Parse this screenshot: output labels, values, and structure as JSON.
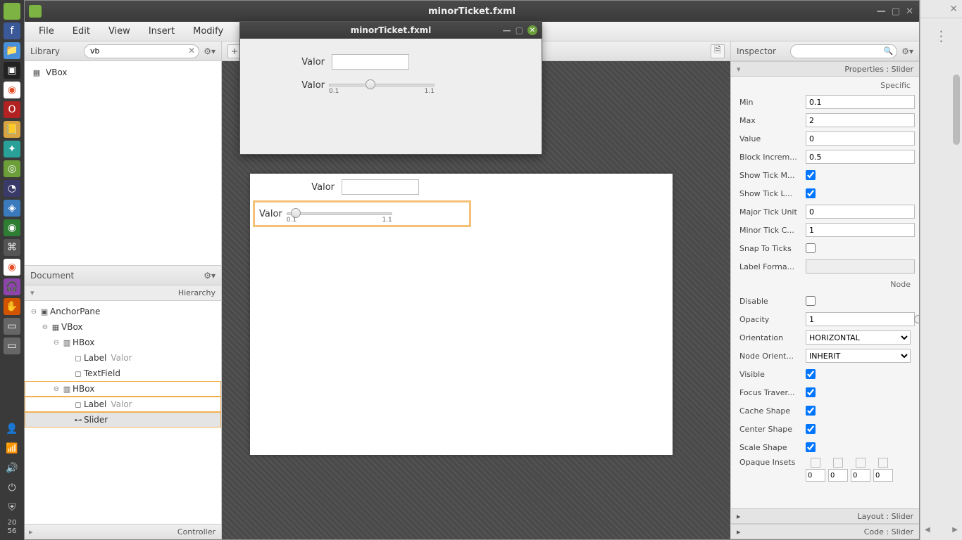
{
  "os": {
    "clock_h": "20",
    "clock_m": "56"
  },
  "window": {
    "title": "minorTicket.fxml"
  },
  "menu": {
    "file": "File",
    "edit": "Edit",
    "view": "View",
    "insert": "Insert",
    "modify": "Modify"
  },
  "library": {
    "title": "Library",
    "search": "vb",
    "item1": "VBox"
  },
  "document": {
    "title": "Document",
    "hierarchy": "Hierarchy",
    "controller": "Controller",
    "tree": {
      "anchor": "AnchorPane",
      "vbox": "VBox",
      "hbox1": "HBox",
      "label": "Label",
      "valor": "Valor",
      "textfield": "TextField",
      "hbox2": "HBox",
      "slider": "Slider"
    }
  },
  "canvas": {
    "label_valor": "Valor",
    "tick_min": "0.1",
    "tick_max": "1.1"
  },
  "preview": {
    "title": "minorTicket.fxml",
    "label_valor": "Valor",
    "tick_min": "0.1",
    "tick_max": "1.1"
  },
  "inspector": {
    "title": "Inspector",
    "properties_label": "Properties : Slider",
    "layout_label": "Layout : Slider",
    "code_label": "Code : Slider",
    "section_specific": "Specific",
    "section_node": "Node",
    "props": {
      "min_l": "Min",
      "min_v": "0.1",
      "max_l": "Max",
      "max_v": "2",
      "value_l": "Value",
      "value_v": "0",
      "blockinc_l": "Block Increm...",
      "blockinc_v": "0.5",
      "showtickm_l": "Show Tick M...",
      "showtickl_l": "Show Tick L...",
      "majortick_l": "Major Tick Unit",
      "majortick_v": "0",
      "minortick_l": "Minor Tick C...",
      "minortick_v": "1",
      "snap_l": "Snap To Ticks",
      "labelfmt_l": "Label Forma...",
      "labelfmt_v": "",
      "disable_l": "Disable",
      "opacity_l": "Opacity",
      "opacity_v": "1",
      "orient_l": "Orientation",
      "orient_v": "HORIZONTAL",
      "nodeorient_l": "Node Orient...",
      "nodeorient_v": "INHERIT",
      "visible_l": "Visible",
      "focus_l": "Focus Traver...",
      "cache_l": "Cache Shape",
      "center_l": "Center Shape",
      "scale_l": "Scale Shape",
      "opaque_l": "Opaque Insets",
      "inset_v": "0"
    }
  }
}
